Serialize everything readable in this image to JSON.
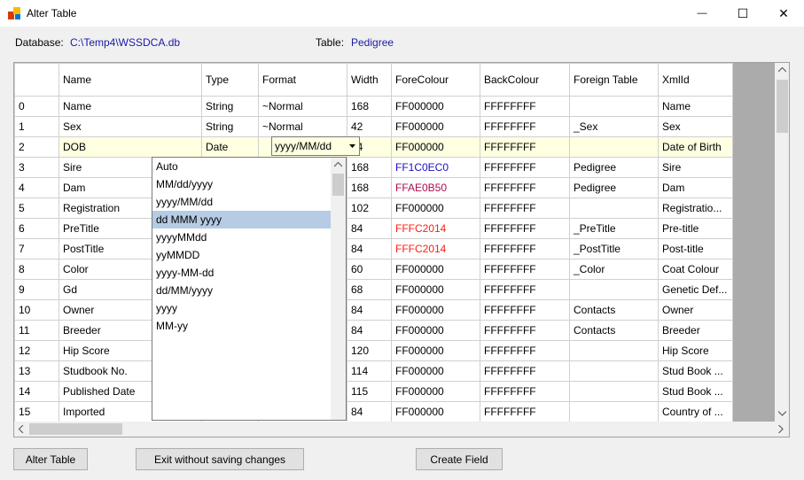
{
  "window": {
    "title": "Alter Table",
    "minimize_glyph": "—",
    "maximize_glyph": "☐",
    "close_glyph": "✕"
  },
  "info": {
    "database_label": "Database:",
    "database_value": "C:\\Temp4\\WSSDCA.db",
    "table_label": "Table:",
    "table_value": "Pedigree"
  },
  "grid": {
    "columns": [
      "",
      "Name",
      "Type",
      "Format",
      "Width",
      "ForeColour",
      "BackColour",
      "Foreign Table",
      "XmlId"
    ],
    "rows": [
      {
        "idx": "0",
        "name": "Name",
        "type": "String",
        "format": "~Normal",
        "width": "168",
        "fore": "FF000000",
        "back": "FFFFFFFF",
        "foreign": "",
        "xml": "Name",
        "fore_color": "#000000"
      },
      {
        "idx": "1",
        "name": "Sex",
        "type": "String",
        "format": "~Normal",
        "width": "42",
        "fore": "FF000000",
        "back": "FFFFFFFF",
        "foreign": "_Sex",
        "xml": "Sex",
        "fore_color": "#000000"
      },
      {
        "idx": "2",
        "name": "DOB",
        "type": "Date",
        "format": "yyyy/MM/dd",
        "width": "84",
        "fore": "FF000000",
        "back": "FFFFFFFF",
        "foreign": "",
        "xml": "Date of Birth",
        "fore_color": "#000000"
      },
      {
        "idx": "3",
        "name": "Sire",
        "type": "",
        "format": "",
        "width": "168",
        "fore": "FF1C0EC0",
        "back": "FFFFFFFF",
        "foreign": "Pedigree",
        "xml": "Sire",
        "fore_color": "#1c0ec0"
      },
      {
        "idx": "4",
        "name": "Dam",
        "type": "",
        "format": "",
        "width": "168",
        "fore": "FFAE0B50",
        "back": "FFFFFFFF",
        "foreign": "Pedigree",
        "xml": "Dam",
        "fore_color": "#ae0b50"
      },
      {
        "idx": "5",
        "name": "Registration",
        "type": "",
        "format": "",
        "width": "102",
        "fore": "FF000000",
        "back": "FFFFFFFF",
        "foreign": "",
        "xml": "Registratio...",
        "fore_color": "#000000"
      },
      {
        "idx": "6",
        "name": "PreTitle",
        "type": "",
        "format": "",
        "width": "84",
        "fore": "FFFC2014",
        "back": "FFFFFFFF",
        "foreign": "_PreTitle",
        "xml": "Pre-title",
        "fore_color": "#fc2014"
      },
      {
        "idx": "7",
        "name": "PostTitle",
        "type": "",
        "format": "",
        "width": "84",
        "fore": "FFFC2014",
        "back": "FFFFFFFF",
        "foreign": "_PostTitle",
        "xml": "Post-title",
        "fore_color": "#fc2014"
      },
      {
        "idx": "8",
        "name": "Color",
        "type": "",
        "format": "",
        "width": "60",
        "fore": "FF000000",
        "back": "FFFFFFFF",
        "foreign": "_Color",
        "xml": "Coat Colour",
        "fore_color": "#000000"
      },
      {
        "idx": "9",
        "name": "Gd",
        "type": "",
        "format": "",
        "width": "68",
        "fore": "FF000000",
        "back": "FFFFFFFF",
        "foreign": "",
        "xml": "Genetic Def...",
        "fore_color": "#000000"
      },
      {
        "idx": "10",
        "name": "Owner",
        "type": "",
        "format": "",
        "width": "84",
        "fore": "FF000000",
        "back": "FFFFFFFF",
        "foreign": "Contacts",
        "xml": "Owner",
        "fore_color": "#000000"
      },
      {
        "idx": "11",
        "name": "Breeder",
        "type": "",
        "format": "",
        "width": "84",
        "fore": "FF000000",
        "back": "FFFFFFFF",
        "foreign": "Contacts",
        "xml": "Breeder",
        "fore_color": "#000000"
      },
      {
        "idx": "12",
        "name": "Hip Score",
        "type": "",
        "format": "",
        "width": "120",
        "fore": "FF000000",
        "back": "FFFFFFFF",
        "foreign": "",
        "xml": "Hip Score",
        "fore_color": "#000000"
      },
      {
        "idx": "13",
        "name": "Studbook No.",
        "type": "",
        "format": "",
        "width": "114",
        "fore": "FF000000",
        "back": "FFFFFFFF",
        "foreign": "",
        "xml": "Stud Book ...",
        "fore_color": "#000000"
      },
      {
        "idx": "14",
        "name": "Published Date",
        "type": "",
        "format": "",
        "width": "115",
        "fore": "FF000000",
        "back": "FFFFFFFF",
        "foreign": "",
        "xml": "Stud Book ...",
        "fore_color": "#000000"
      },
      {
        "idx": "15",
        "name": "Imported",
        "type": "",
        "format": "",
        "width": "84",
        "fore": "FF000000",
        "back": "FFFFFFFF",
        "foreign": "",
        "xml": "Country of ...",
        "fore_color": "#000000"
      }
    ],
    "selected_row_index": 2
  },
  "format_combo": {
    "value": "yyyy/MM/dd",
    "options": [
      "Auto",
      "MM/dd/yyyy",
      "yyyy/MM/dd",
      "dd MMM yyyy",
      "yyyyMMdd",
      "yyMMDD",
      "yyyy-MM-dd",
      "dd/MM/yyyy",
      "yyyy",
      "MM-yy"
    ],
    "highlighted_option": "dd MMM yyyy"
  },
  "buttons": {
    "alter_table": "Alter Table",
    "exit_without_saving": "Exit without saving changes",
    "create_field": "Create Field"
  },
  "colors": {
    "accent_link": "#1a1aa8",
    "selected_row": "#ffffe1",
    "dropdown_highlight": "#b6cbe4"
  }
}
